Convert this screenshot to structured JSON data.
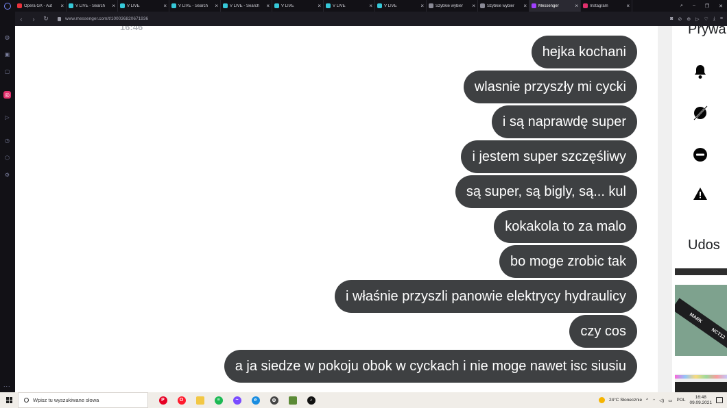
{
  "browser": {
    "tabs": [
      {
        "title": "Opera GX - Aut",
        "color": "#e8323c"
      },
      {
        "title": "V LIVE - Search",
        "color": "#36c8d8"
      },
      {
        "title": "V LIVE",
        "color": "#36c8d8"
      },
      {
        "title": "V LIVE - Search",
        "color": "#36c8d8"
      },
      {
        "title": "V LIVE - Search",
        "color": "#36c8d8"
      },
      {
        "title": "V LIVE",
        "color": "#36c8d8"
      },
      {
        "title": "V LIVE",
        "color": "#36c8d8"
      },
      {
        "title": "V LIVE",
        "color": "#36c8d8"
      },
      {
        "title": "Szybkie wybier",
        "color": "#8a8a96"
      },
      {
        "title": "Szybkie wybier",
        "color": "#8a8a96"
      },
      {
        "title": "Messenger",
        "color": "#a040ff",
        "active": true
      },
      {
        "title": "Instagram",
        "color": "#e1306c"
      }
    ],
    "url": "www.messenger.com/t/100036820671936",
    "sidebar_icons": [
      "speed-dial-icon",
      "shopping-bag-icon",
      "twitch-icon",
      "instagram-icon",
      "player-icon",
      "history-icon",
      "box-icon",
      "settings-icon"
    ],
    "sidebar_more": "..."
  },
  "chat": {
    "timestamp": "16:46",
    "messages": [
      "hejka kochani",
      "wlasnie przyszły mi cycki",
      "i są naprawdę super",
      "i jestem super szczęśliwy",
      "są super, są bigly, są... kul",
      "kokakola to za malo",
      "bo moge zrobic tak",
      "i właśnie przyszli panowie elektrycy hydraulicy",
      "czy cos",
      "a ja siedze w pokoju obok w cyckach i nie moge nawet isc siusiu"
    ],
    "bubble_color": "#3e4042"
  },
  "right_panel": {
    "privacy_title": "Prywa",
    "icons": [
      "bell-icon",
      "eye-slash-icon",
      "block-icon",
      "warning-icon"
    ],
    "shared_title": "Udos",
    "thumb_text": [
      "MARK",
      "NCT12"
    ]
  },
  "taskbar": {
    "search_placeholder": "Wpisz tu wyszukiwane słowa",
    "apps": [
      {
        "name": "pinterest",
        "color": "#e60023",
        "glyph": "P"
      },
      {
        "name": "opera",
        "color": "#ff1b2d",
        "glyph": "O"
      },
      {
        "name": "file-explorer",
        "color": "#f2c744",
        "glyph": ""
      },
      {
        "name": "spotify",
        "color": "#1db954",
        "glyph": "≡"
      },
      {
        "name": "messenger",
        "color": "#7a4cff",
        "glyph": "~"
      },
      {
        "name": "edge",
        "color": "#1a8de0",
        "glyph": "e"
      },
      {
        "name": "settings",
        "color": "#444444",
        "glyph": "⚙"
      },
      {
        "name": "minecraft",
        "color": "#5b8a36",
        "glyph": ""
      },
      {
        "name": "tiktok",
        "color": "#111111",
        "glyph": "♪"
      }
    ],
    "weather": "24°C  Słonecznie",
    "language": "POL",
    "time": "16:48",
    "date": "09.09.2021"
  }
}
